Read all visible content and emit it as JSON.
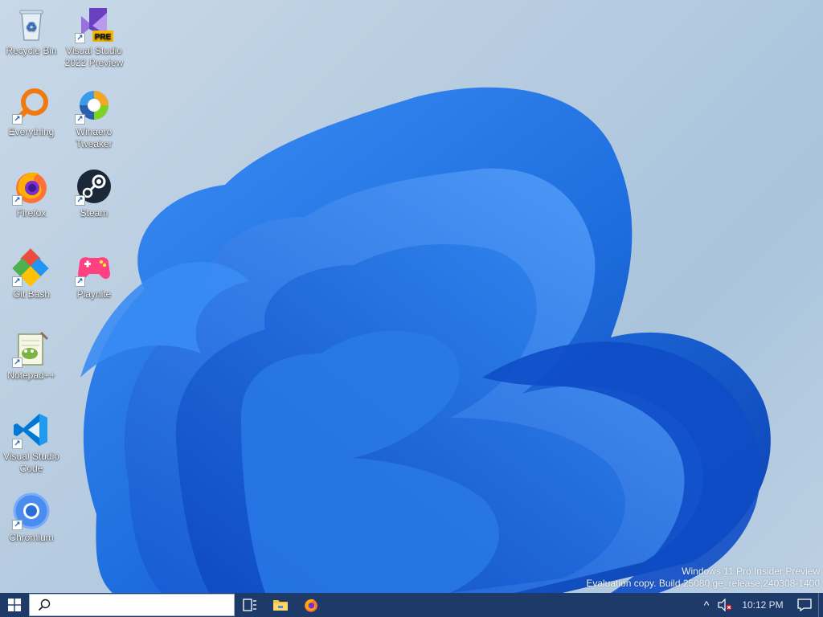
{
  "desktop": {
    "icons": [
      {
        "label": "Recycle Bin",
        "icon": "recycle-bin-icon",
        "shortcut": false
      },
      {
        "label": "Visual Studio 2022 Preview",
        "icon": "visual-studio-preview-icon",
        "shortcut": true,
        "badge": "PRE"
      },
      {
        "label": "Everything",
        "icon": "everything-icon",
        "shortcut": true
      },
      {
        "label": "Winaero Tweaker",
        "icon": "winaero-tweaker-icon",
        "shortcut": true
      },
      {
        "label": "Firefox",
        "icon": "firefox-icon",
        "shortcut": true
      },
      {
        "label": "Steam",
        "icon": "steam-icon",
        "shortcut": true
      },
      {
        "label": "Git Bash",
        "icon": "git-bash-icon",
        "shortcut": true
      },
      {
        "label": "Playnite",
        "icon": "playnite-icon",
        "shortcut": true
      },
      {
        "label": "Notepad++",
        "icon": "notepad-plus-plus-icon",
        "shortcut": true
      },
      {
        "label": "Visual Studio Code",
        "icon": "vscode-icon",
        "shortcut": true
      },
      {
        "label": "Chromium",
        "icon": "chromium-icon",
        "shortcut": true
      }
    ],
    "watermark": {
      "line1": "Windows 11 Pro Insider Preview",
      "line2": "Evaluation copy. Build 25080.ge_release.240308-1400"
    }
  },
  "taskbar": {
    "search_placeholder": "",
    "pinned": [
      {
        "name": "task-view",
        "icon": "task-view-icon"
      },
      {
        "name": "file-explorer",
        "icon": "file-explorer-icon"
      },
      {
        "name": "firefox",
        "icon": "firefox-icon"
      }
    ],
    "tray": {
      "chevron": "^",
      "clock": "10:12 PM"
    }
  },
  "colors": {
    "taskbar_bg": "#1d3a68",
    "bloom_blue": "#1f6fe0",
    "bloom_deep": "#0b3fb0"
  }
}
